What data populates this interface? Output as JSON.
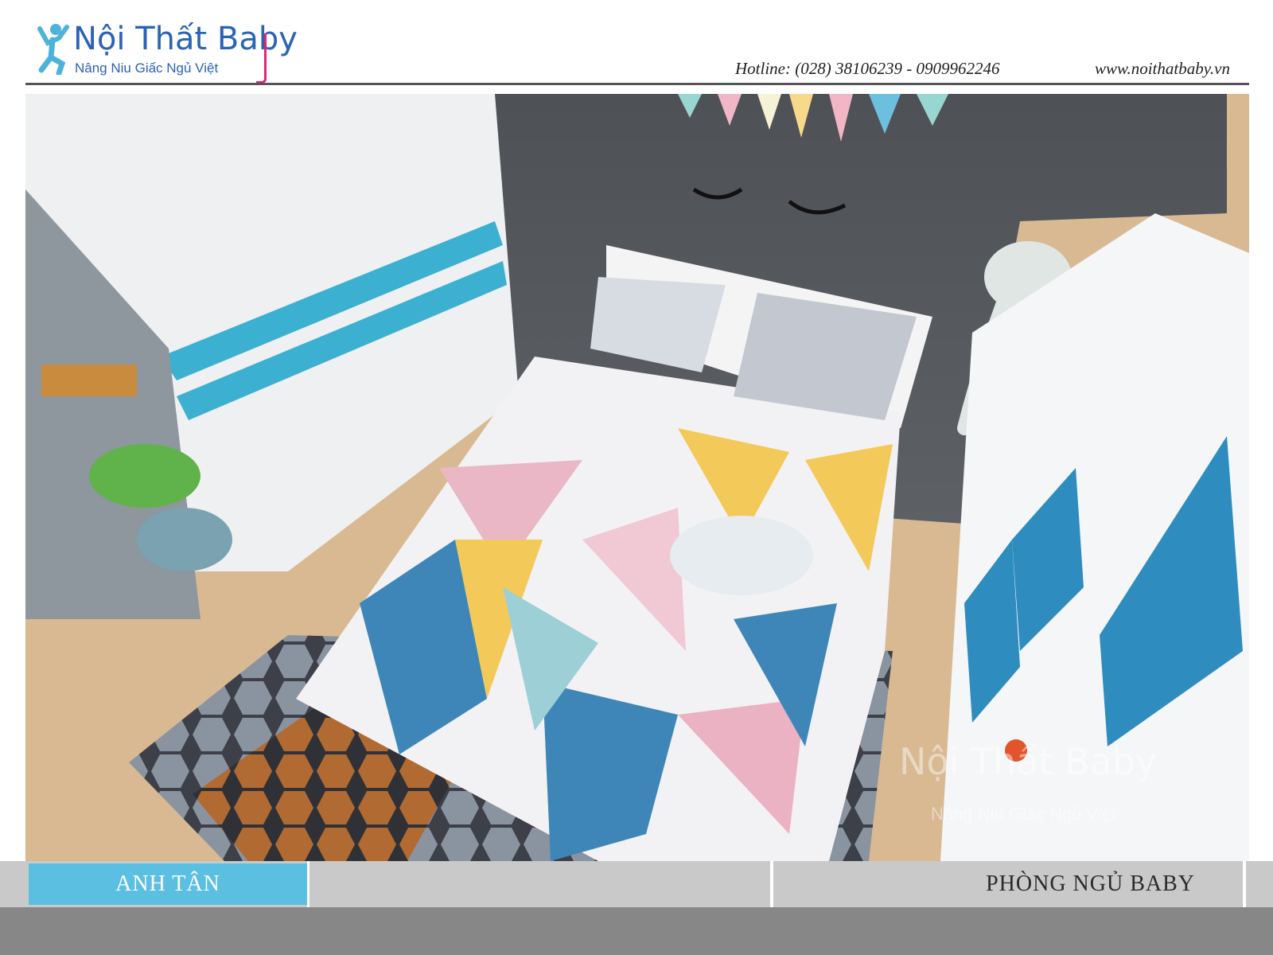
{
  "header": {
    "logo_title": "Nội Thất Baby",
    "logo_tagline": "Nâng Niu Giấc Ngủ Việt",
    "hotline": "Hotline: (028) 38106239  - 0909962246",
    "website": "www.noithatbaby.vn"
  },
  "watermark": {
    "title": "Nội Thất Baby",
    "tagline": "Nâng Niu Giấc Ngủ Việt"
  },
  "footer": {
    "client_label": "ANH TÂN",
    "room_label": "PHÒNG NGỦ BABY"
  },
  "colors": {
    "brand_blue": "#2b63b5",
    "brand_pink": "#e0247a",
    "accent_cyan": "#5bbfe2",
    "footer_gray": "#c9c9c9",
    "band_gray": "#878787"
  },
  "icons": [
    "logo-child-icon",
    "room-render-image"
  ]
}
